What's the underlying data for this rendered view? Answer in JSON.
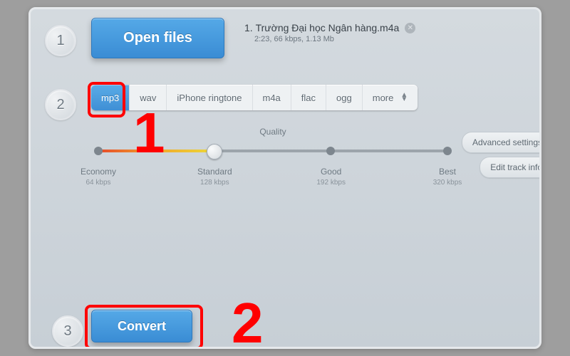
{
  "steps": {
    "s1": "1",
    "s2": "2",
    "s3": "3"
  },
  "open_files_label": "Open files",
  "file": {
    "index": "1.",
    "name": "Trường Đại học Ngân hàng.m4a",
    "meta": "2:23, 66 kbps, 1.13 Mb"
  },
  "formats": {
    "mp3": "mp3",
    "wav": "wav",
    "ringtone": "iPhone ringtone",
    "m4a": "m4a",
    "flac": "flac",
    "ogg": "ogg",
    "more": "more"
  },
  "quality": {
    "title": "Quality",
    "ticks": [
      {
        "label": "Economy",
        "rate": "64 kbps"
      },
      {
        "label": "Standard",
        "rate": "128 kbps"
      },
      {
        "label": "Good",
        "rate": "192 kbps"
      },
      {
        "label": "Best",
        "rate": "320 kbps"
      }
    ],
    "selected_index": 1
  },
  "side": {
    "advanced": "Advanced settings",
    "edit_track": "Edit track info"
  },
  "convert_label": "Convert",
  "annotations": {
    "n1": "1",
    "n2": "2"
  }
}
